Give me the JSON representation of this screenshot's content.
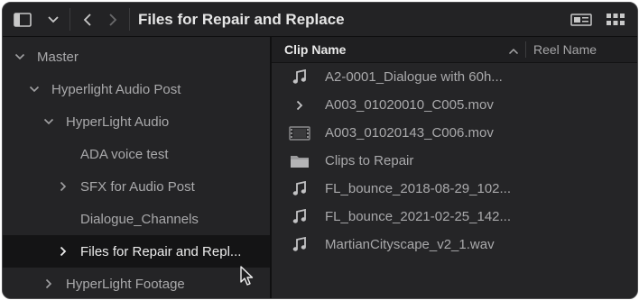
{
  "toolbar": {
    "title": "Files for Repair and Replace",
    "icons": [
      "sidebar-toggle-icon",
      "chevron-down-icon",
      "back-arrow-icon",
      "forward-arrow-icon",
      "metadata-view-icon",
      "thumbnail-grid-view-icon"
    ]
  },
  "sidebar": {
    "items": [
      {
        "label": "Master",
        "indent": 0,
        "chevron": "down"
      },
      {
        "label": "Hyperlight Audio Post",
        "indent": 1,
        "chevron": "down"
      },
      {
        "label": "HyperLight Audio",
        "indent": 2,
        "chevron": "down"
      },
      {
        "label": "ADA voice test",
        "indent": 3,
        "chevron": "none"
      },
      {
        "label": "SFX for Audio Post",
        "indent": 3,
        "chevron": "right"
      },
      {
        "label": "Dialogue_Channels",
        "indent": 3,
        "chevron": "none"
      },
      {
        "label": "Files for Repair and Repl...",
        "indent": 3,
        "chevron": "right",
        "selected": true
      },
      {
        "label": "HyperLight Footage",
        "indent": 2,
        "chevron": "right"
      }
    ]
  },
  "list": {
    "columns": {
      "clip_name": "Clip Name",
      "reel_name": "Reel Name"
    },
    "sort": "ascending",
    "rows": [
      {
        "icon": "audio-note-icon",
        "name": "A2-0001_Dialogue with 60h..."
      },
      {
        "icon": "expand-chevron-icon",
        "name": "A003_01020010_C005.mov"
      },
      {
        "icon": "film-clip-icon",
        "name": "A003_01020143_C006.mov"
      },
      {
        "icon": "folder-icon",
        "name": "Clips to Repair"
      },
      {
        "icon": "audio-note-icon",
        "name": "FL_bounce_2018-08-29_102..."
      },
      {
        "icon": "audio-note-icon",
        "name": "FL_bounce_2021-02-25_142..."
      },
      {
        "icon": "audio-note-icon",
        "name": "MartianCityscape_v2_1.wav"
      }
    ]
  },
  "colors": {
    "background": "#1d1d1f",
    "sidebar": "#242426",
    "list": "#252527",
    "selected_row": "#141415",
    "text": "#a9a9ab",
    "text_bright": "#e6e6e6"
  }
}
